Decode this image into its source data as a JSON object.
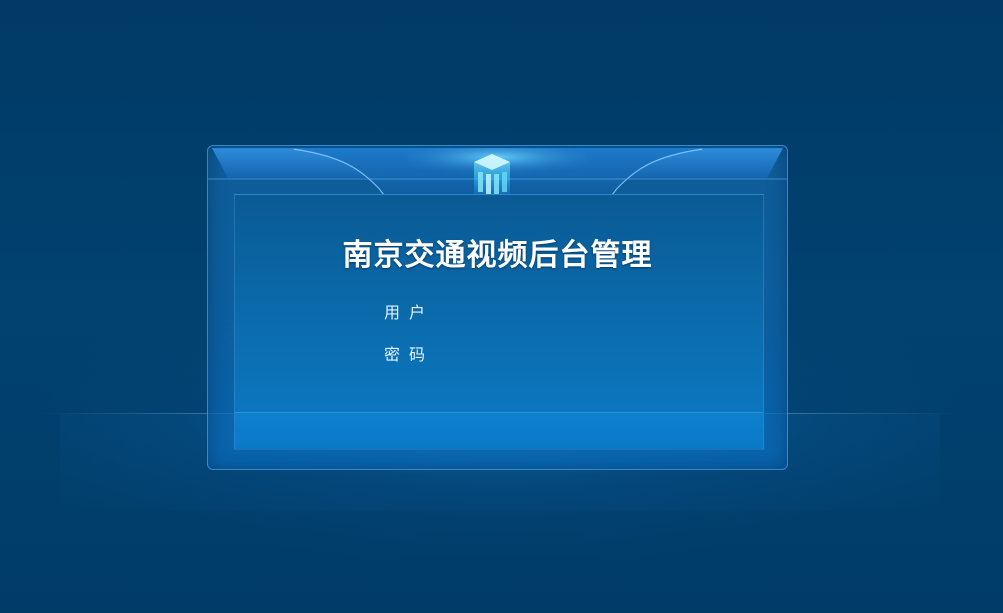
{
  "login": {
    "title": "南京交通视频后台管理",
    "username_label": "用户",
    "password_label": "密码",
    "username_value": "",
    "password_value": ""
  },
  "icons": {
    "logo": "building-logo-icon"
  },
  "colors": {
    "background": "#013d6b",
    "panel_accent": "#1a8be0",
    "logo_glow": "#3fe0ff"
  }
}
